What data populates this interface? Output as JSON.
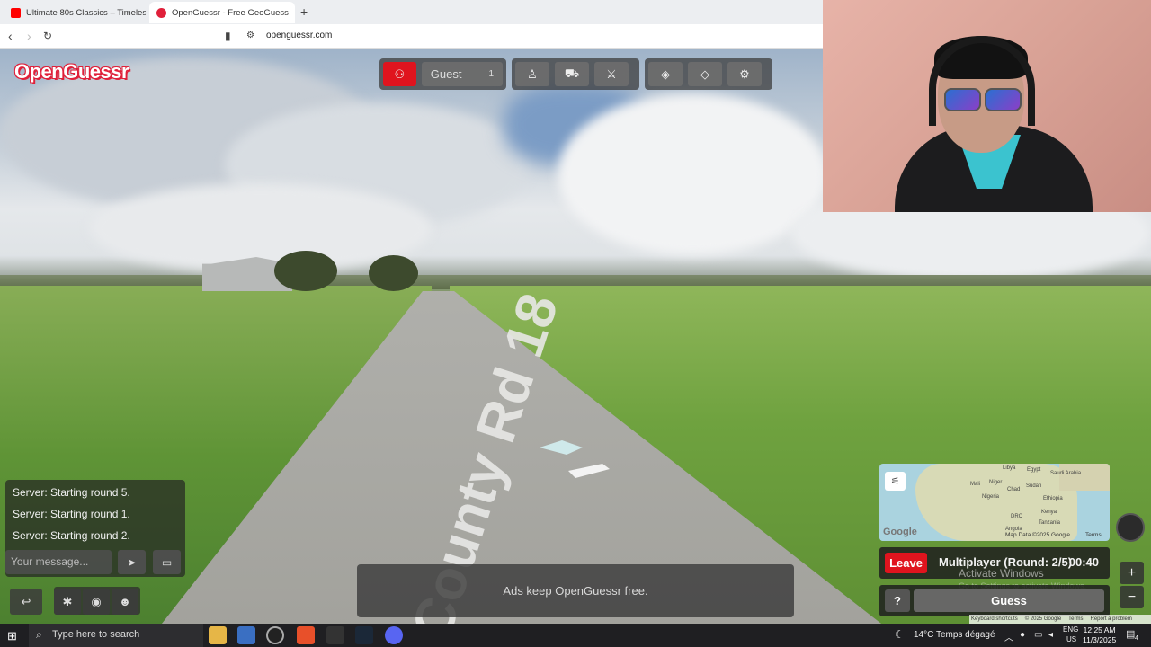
{
  "browser": {
    "tabs": [
      {
        "title": "Ultimate 80s Classics – Timeless",
        "active": false
      },
      {
        "title": "OpenGuessr - Free GeoGuess",
        "active": true
      }
    ],
    "url": "openguessr.com"
  },
  "game": {
    "logo": "OpenGuessr",
    "player_name": "Guest",
    "player_count": "1",
    "road_marking": "County Rd 18",
    "chat": {
      "messages": [
        "Server: Starting round 5.",
        "Server: Starting round 1.",
        "Server: Starting round 2."
      ],
      "placeholder": "Your message..."
    },
    "ads_text": "Ads keep OpenGuessr free.",
    "map": {
      "labels": [
        "Libya",
        "Egypt",
        "Saudi Arabia",
        "Mali",
        "Niger",
        "Chad",
        "Sudan",
        "Nigeria",
        "Ethiopia",
        "DRC",
        "Kenya",
        "Tanzania",
        "Angola"
      ],
      "attribution": "Map Data ©2025 Google",
      "terms": "Terms",
      "google": "Google"
    },
    "leave_label": "Leave",
    "round_text": "Multiplayer (Round: 2/5)",
    "timer": "00:40",
    "help_label": "?",
    "guess_label": "Guess",
    "zoom_in": "+",
    "zoom_out": "−",
    "watermark": {
      "line1": "Activate Windows",
      "line2": "Go to Settings to activate Windows."
    },
    "footer_links": [
      "Keyboard shortcuts",
      "© 2025 Google",
      "Terms",
      "Report a problem"
    ]
  },
  "taskbar": {
    "search_placeholder": "Type here to search",
    "weather": "14°C  Temps dégagé",
    "lang": "ENG",
    "region": "US",
    "time": "12:25 AM",
    "date": "11/3/2025",
    "notifications": "4"
  },
  "colors": {
    "accent": "#e0141e",
    "brand": "#e0203a"
  }
}
